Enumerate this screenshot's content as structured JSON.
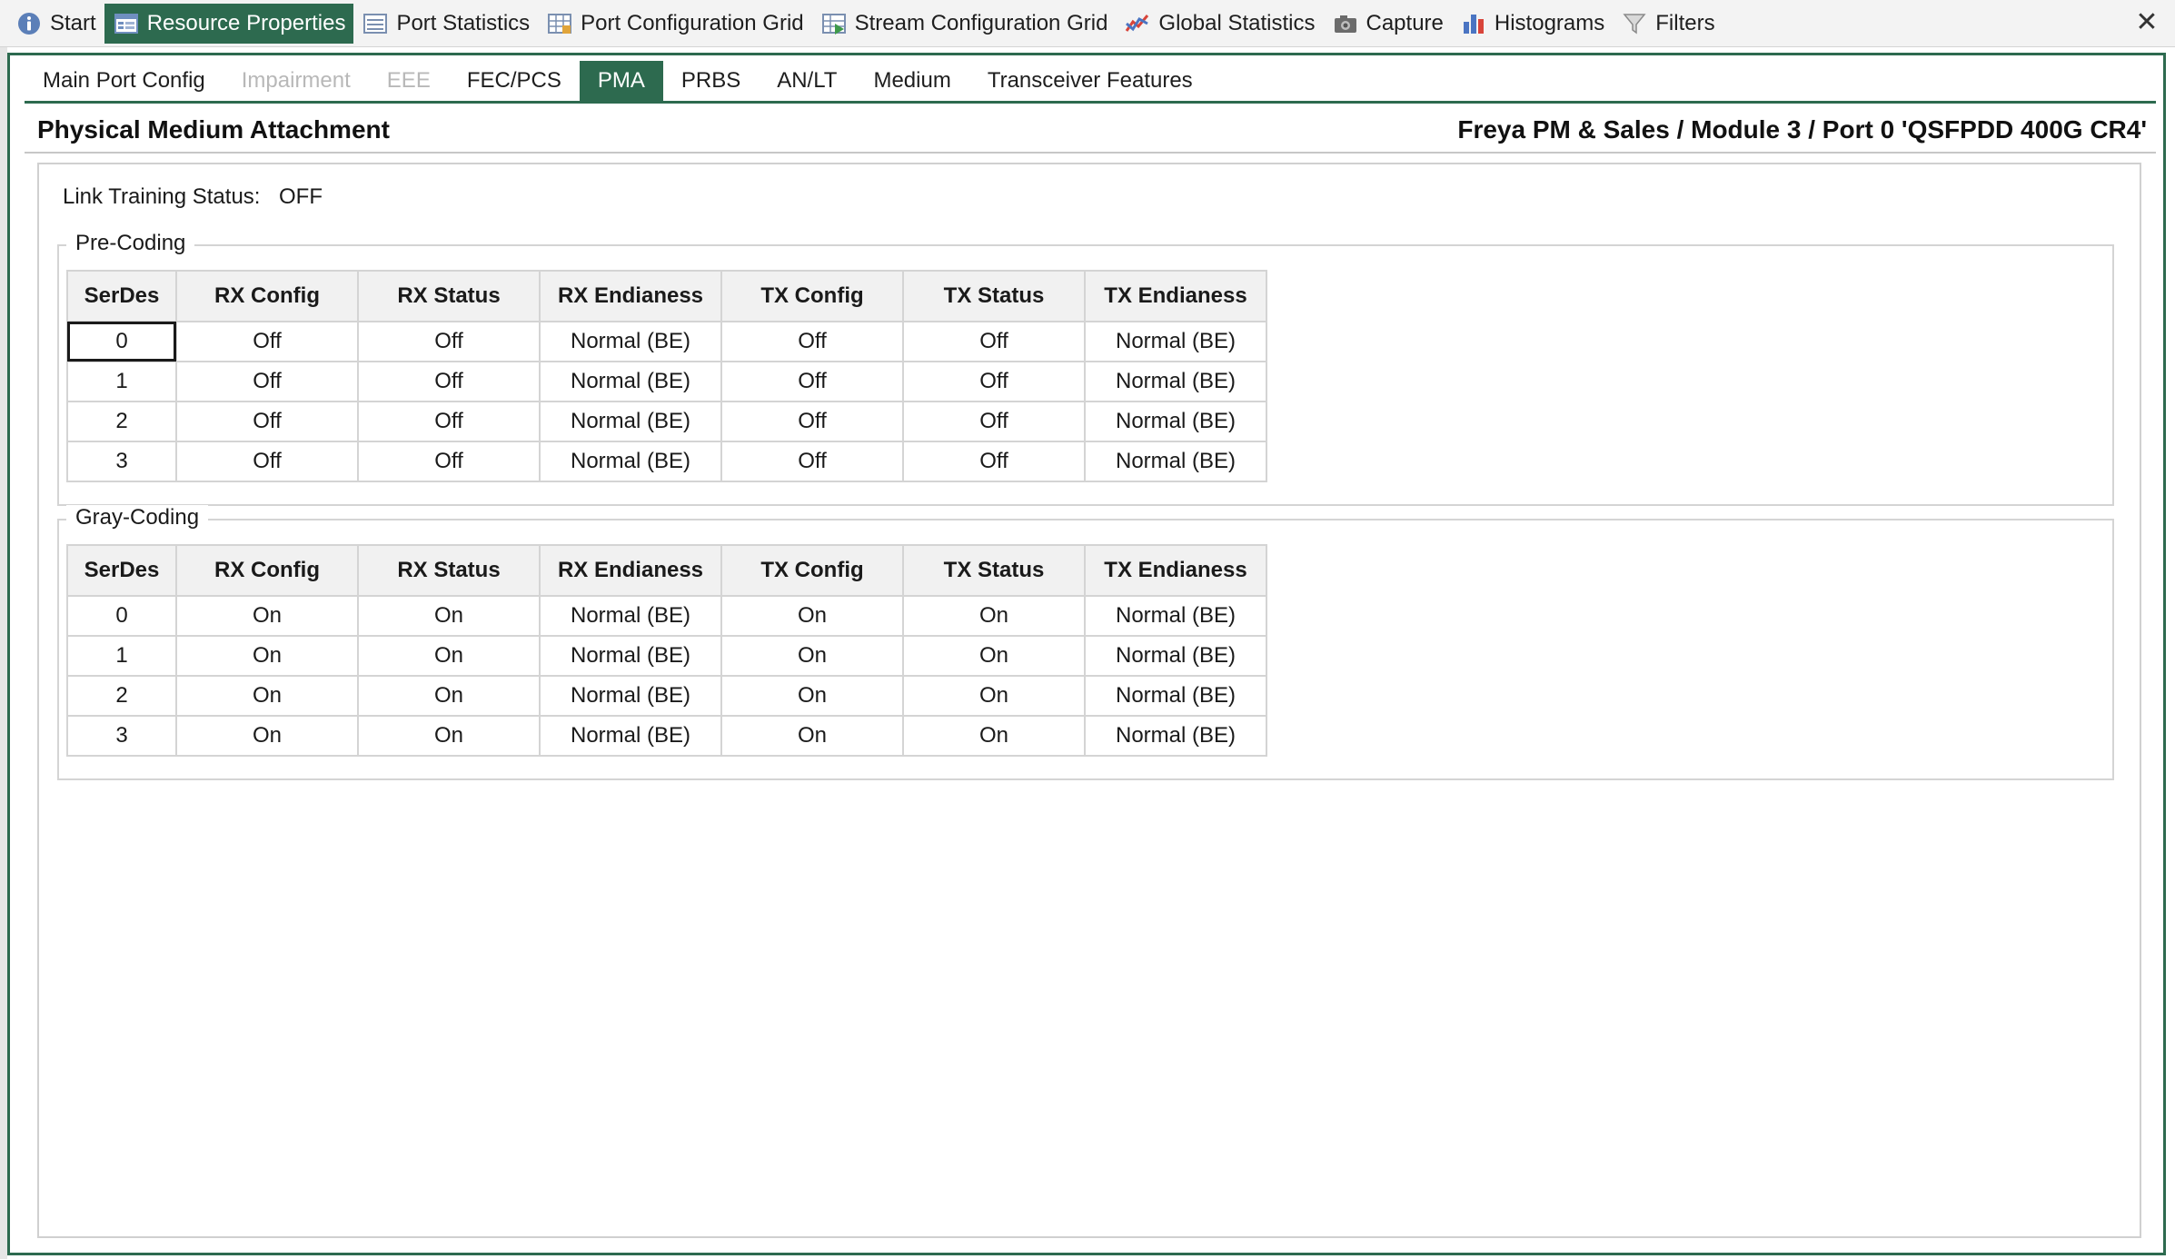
{
  "top_tabs": [
    {
      "label": "Start",
      "icon": "info-icon",
      "active": false
    },
    {
      "label": "Resource Properties",
      "icon": "properties-icon",
      "active": true
    },
    {
      "label": "Port Statistics",
      "icon": "statistics-icon",
      "active": false
    },
    {
      "label": "Port Configuration Grid",
      "icon": "grid-icon",
      "active": false
    },
    {
      "label": "Stream Configuration Grid",
      "icon": "stream-grid-icon",
      "active": false
    },
    {
      "label": "Global Statistics",
      "icon": "line-chart-icon",
      "active": false
    },
    {
      "label": "Capture",
      "icon": "camera-icon",
      "active": false
    },
    {
      "label": "Histograms",
      "icon": "histogram-icon",
      "active": false
    },
    {
      "label": "Filters",
      "icon": "filter-icon",
      "active": false
    }
  ],
  "close_glyph": "✕",
  "sub_tabs": [
    {
      "label": "Main Port Config",
      "state": "normal"
    },
    {
      "label": "Impairment",
      "state": "disabled"
    },
    {
      "label": "EEE",
      "state": "disabled"
    },
    {
      "label": "FEC/PCS",
      "state": "normal"
    },
    {
      "label": "PMA",
      "state": "active"
    },
    {
      "label": "PRBS",
      "state": "normal"
    },
    {
      "label": "AN/LT",
      "state": "normal"
    },
    {
      "label": "Medium",
      "state": "normal"
    },
    {
      "label": "Transceiver Features",
      "state": "normal"
    }
  ],
  "header": {
    "title": "Physical Medium Attachment",
    "path": "Freya PM & Sales / Module 3 / Port 0 'QSFPDD 400G CR4'"
  },
  "link_training": {
    "label": "Link Training Status:",
    "value": "OFF"
  },
  "columns": [
    "SerDes",
    "RX Config",
    "RX Status",
    "RX Endianess",
    "TX Config",
    "TX Status",
    "TX Endianess"
  ],
  "pre_coding": {
    "title": "Pre-Coding",
    "rows": [
      [
        "0",
        "Off",
        "Off",
        "Normal (BE)",
        "Off",
        "Off",
        "Normal (BE)"
      ],
      [
        "1",
        "Off",
        "Off",
        "Normal (BE)",
        "Off",
        "Off",
        "Normal (BE)"
      ],
      [
        "2",
        "Off",
        "Off",
        "Normal (BE)",
        "Off",
        "Off",
        "Normal (BE)"
      ],
      [
        "3",
        "Off",
        "Off",
        "Normal (BE)",
        "Off",
        "Off",
        "Normal (BE)"
      ]
    ]
  },
  "gray_coding": {
    "title": "Gray-Coding",
    "rows": [
      [
        "0",
        "On",
        "On",
        "Normal (BE)",
        "On",
        "On",
        "Normal (BE)"
      ],
      [
        "1",
        "On",
        "On",
        "Normal (BE)",
        "On",
        "On",
        "Normal (BE)"
      ],
      [
        "2",
        "On",
        "On",
        "Normal (BE)",
        "On",
        "On",
        "Normal (BE)"
      ],
      [
        "3",
        "On",
        "On",
        "Normal (BE)",
        "On",
        "On",
        "Normal (BE)"
      ]
    ]
  },
  "colors": {
    "accent": "#2d6a4f",
    "header_bg": "#f1f1f1",
    "disabled_text": "#b8b8b8"
  }
}
